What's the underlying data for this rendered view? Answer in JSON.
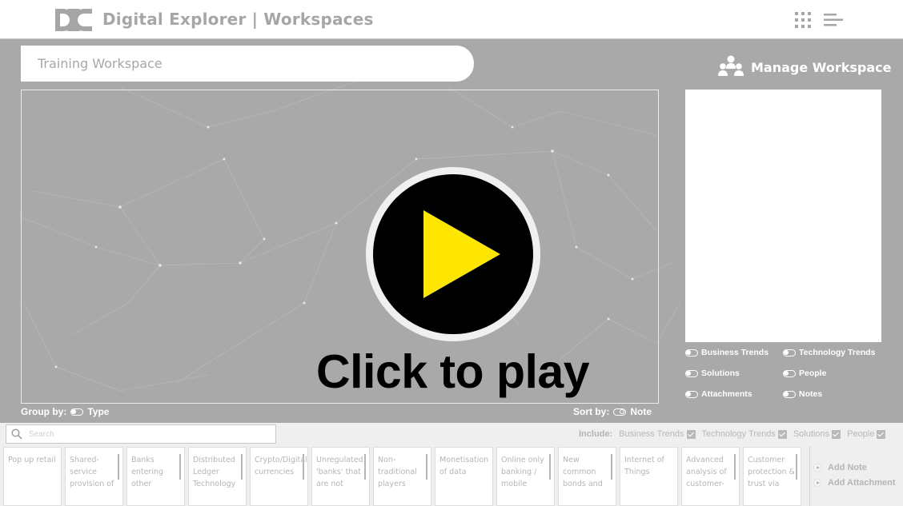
{
  "header": {
    "app_title": "Digital Explorer | Workspaces",
    "icons": [
      "dxc-logo-icon",
      "apps-grid-icon",
      "menu-icon"
    ]
  },
  "workspace": {
    "name": "Training Workspace",
    "manage_label": "Manage Workspace"
  },
  "filters": [
    {
      "label": "Business Trends",
      "on": true
    },
    {
      "label": "Technology Trends",
      "on": true
    },
    {
      "label": "Solutions",
      "on": true
    },
    {
      "label": "People",
      "on": true
    },
    {
      "label": "Attachments",
      "on": true
    },
    {
      "label": "Notes",
      "on": true
    }
  ],
  "group_by": {
    "label": "Group by:",
    "value": "Type"
  },
  "sort_by": {
    "label": "Sort by:",
    "value": "Note"
  },
  "overlay": {
    "label": "Click to play",
    "accent": "#ffe600"
  },
  "search": {
    "placeholder": "Search"
  },
  "include": {
    "label": "Include:",
    "items": [
      "Business Trends",
      "Technology Trends",
      "Solutions",
      "People"
    ]
  },
  "cards": [
    {
      "text": "Pop up retail"
    },
    {
      "text": "Shared-service provision of"
    },
    {
      "text": "Banks entering other"
    },
    {
      "text": "Distributed Ledger Technology"
    },
    {
      "text": "Crypto/Digital currencies"
    },
    {
      "text": "Unregulated 'banks' that are not"
    },
    {
      "text": "Non-traditional players"
    },
    {
      "text": "Monetisation of data"
    },
    {
      "text": "Online only banking / mobile"
    },
    {
      "text": "New common bonds and"
    },
    {
      "text": "Internet of Things"
    },
    {
      "text": "Advanced analysis of customer-"
    },
    {
      "text": "Customer protection & trust via"
    }
  ],
  "actions": {
    "add_note": "Add Note",
    "add_attachment": "Add Attachment"
  },
  "colors": {
    "background": "#a9a9a9",
    "header": "#ffffff",
    "play_icon": "#ffe600"
  }
}
